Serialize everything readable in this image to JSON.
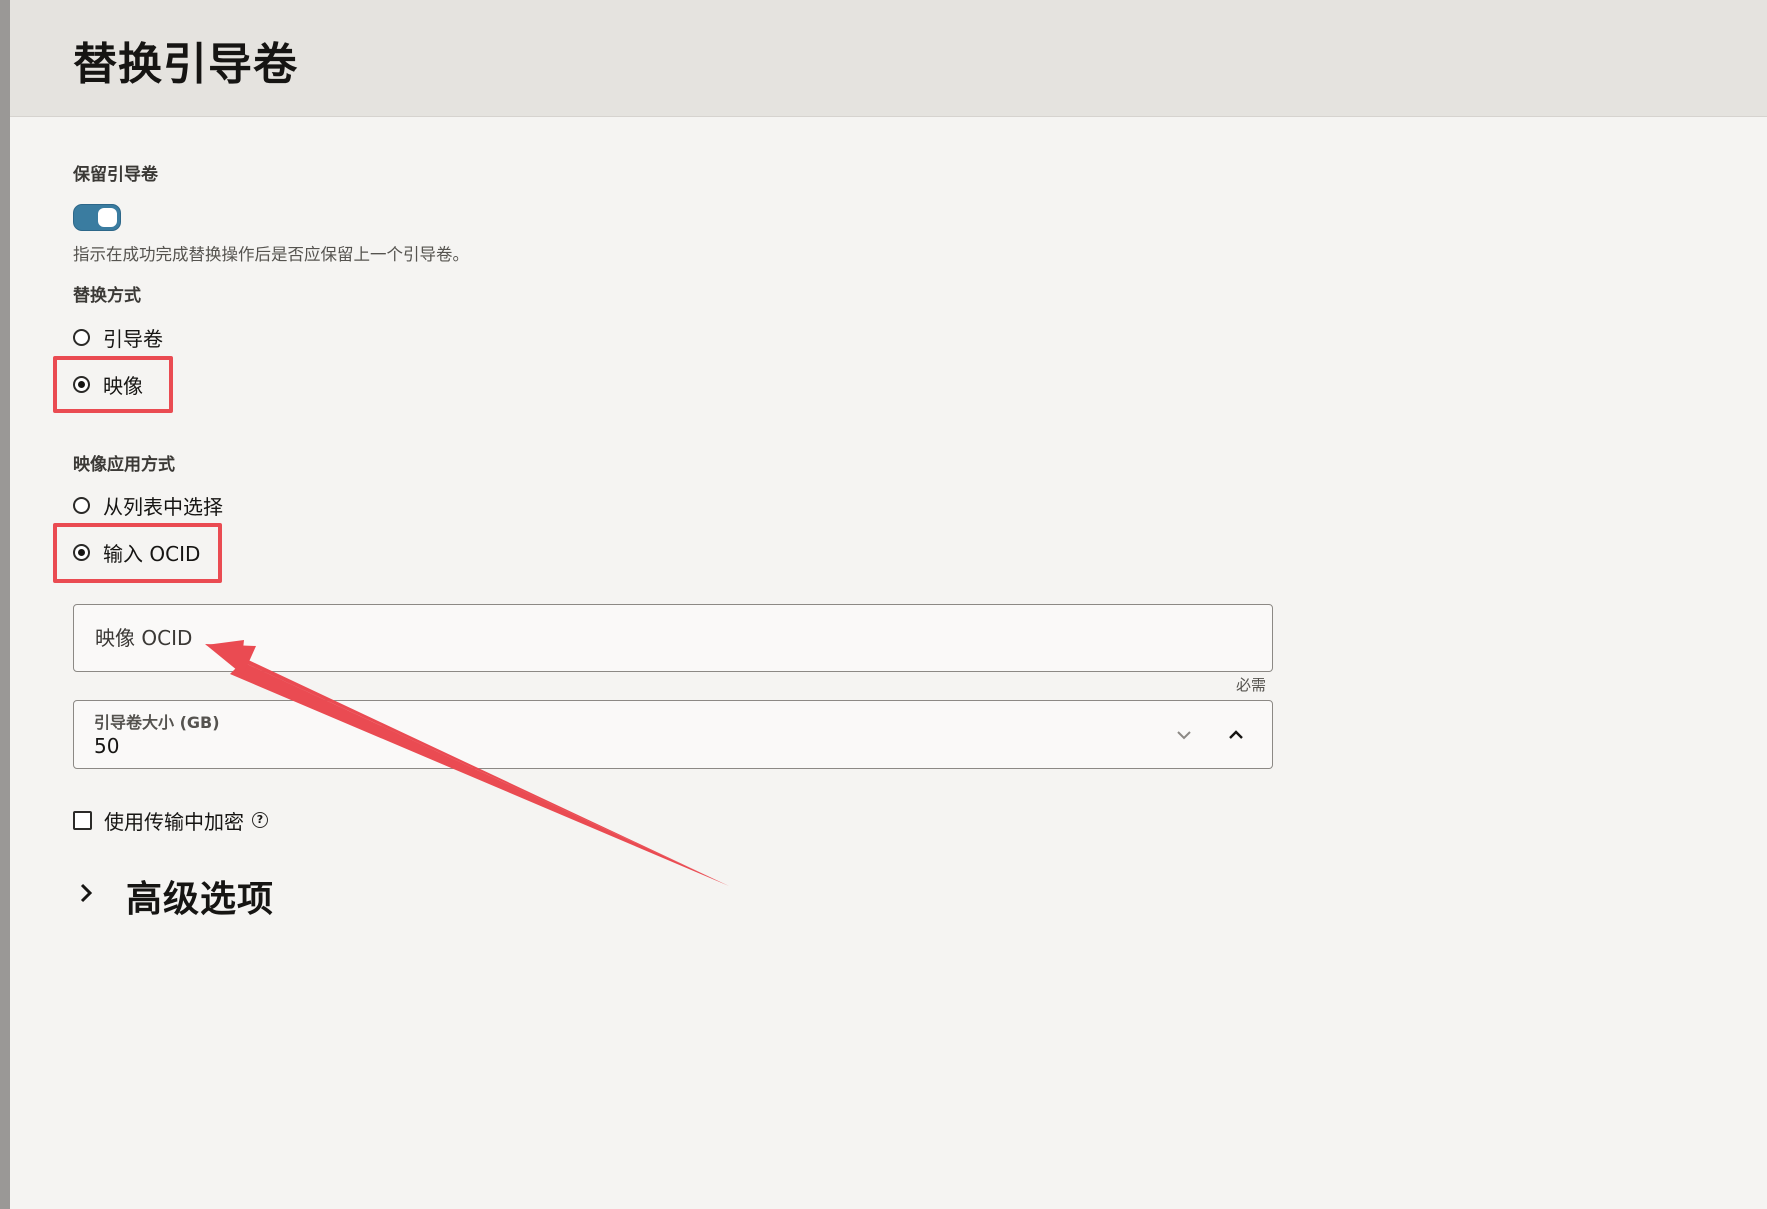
{
  "dialog": {
    "title": "替换引导卷"
  },
  "preserve": {
    "label": "保留引导卷",
    "toggle_on": true,
    "help": "指示在成功完成替换操作后是否应保留上一个引导卷。"
  },
  "replace_by": {
    "label": "替换方式",
    "options": [
      {
        "label": "引导卷",
        "selected": false
      },
      {
        "label": "映像",
        "selected": true
      }
    ]
  },
  "image_method": {
    "label": "映像应用方式",
    "options": [
      {
        "label": "从列表中选择",
        "selected": false
      },
      {
        "label": "输入 OCID",
        "selected": true
      }
    ]
  },
  "image_ocid": {
    "placeholder": "映像 OCID",
    "value": "",
    "required_text": "必需"
  },
  "boot_volume_size": {
    "label": "引导卷大小 (GB)",
    "value": "50"
  },
  "encryption": {
    "label": "使用传输中加密",
    "checked": false,
    "help_icon": "question-circle-icon"
  },
  "advanced": {
    "label": "高级选项",
    "expanded": false,
    "icon": "chevron-right-icon"
  },
  "annotation": {
    "color": "#ea4b52"
  }
}
